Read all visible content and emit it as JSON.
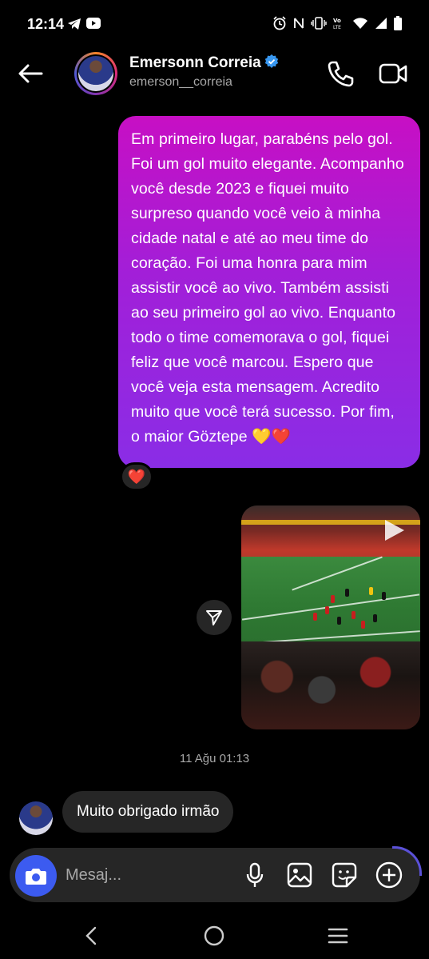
{
  "status_bar": {
    "time": "12:14",
    "left_icons": [
      "telegram-icon",
      "youtube-icon"
    ],
    "right_icons": [
      "alarm-icon",
      "nfc-icon",
      "vibrate-icon",
      "volte-icon",
      "wifi-icon",
      "signal-icon",
      "battery-icon"
    ]
  },
  "header": {
    "name": "Emersonn Correia",
    "username": "emerson__correia",
    "verified": true
  },
  "messages": {
    "sent_text": "Em primeiro lugar, parabéns pelo gol. Foi um gol muito elegante. Acompanho você desde 2023 e fiquei muito surpreso quando você veio à minha cidade natal e até ao meu time do coração. Foi uma honra para mim assistir você ao vivo. Também assisti ao seu primeiro gol ao vivo. Enquanto todo o time comemorava o gol, fiquei feliz que você marcou. Espero que você veja esta mensagem. Acredito muito que você terá sucesso. Por fim, o maior Göztepe 💛❤️",
    "reaction": "❤️",
    "timestamp": "11 Ağu 01:13",
    "received_text": "Muito obrigado irmão"
  },
  "composer": {
    "placeholder": "Mesaj..."
  },
  "colors": {
    "bubble_top": "#c70fc4",
    "bubble_bottom": "#8a2de6",
    "camera_button": "#3c5bf0",
    "surface": "#262626",
    "muted_text": "#a8a8a8"
  }
}
